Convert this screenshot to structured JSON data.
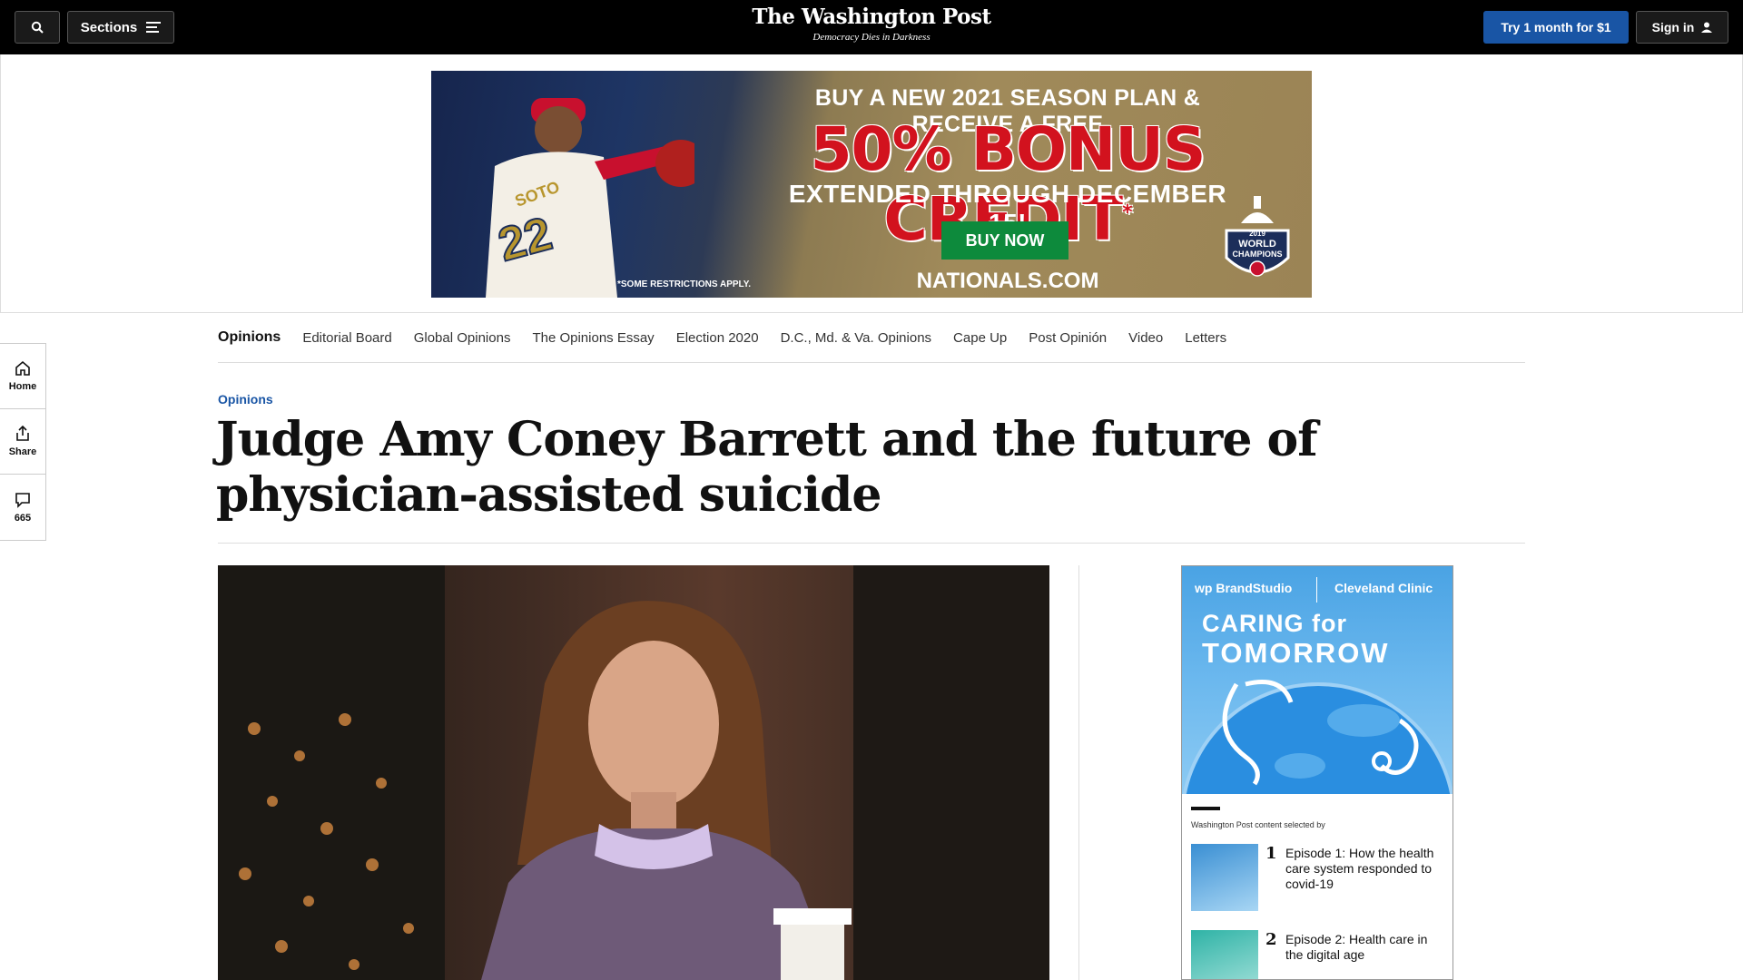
{
  "header": {
    "sections_label": "Sections",
    "logo": "The Washington Post",
    "tagline": "Democracy Dies in Darkness",
    "trial_label": "Try 1 month for $1",
    "signin_label": "Sign in"
  },
  "ad": {
    "line1": "BUY A NEW 2021 SEASON PLAN & RECEIVE A FREE",
    "line2": "50% BONUS CREDIT",
    "line2_mark": "*",
    "line3": "EXTENDED THROUGH DECEMBER 15!",
    "cta": "BUY NOW",
    "restrictions": "*SOME RESTRICTIONS APPLY.",
    "site": "NATIONALS.COM",
    "jersey_name": "SOTO",
    "jersey_number": "22",
    "badge_year": "2019",
    "badge_line1": "WORLD",
    "badge_line2": "CHAMPIONS"
  },
  "rail": {
    "home_label": "Home",
    "share_label": "Share",
    "comments_count": "665"
  },
  "nav": {
    "items": [
      "Opinions",
      "Editorial Board",
      "Global Opinions",
      "The Opinions Essay",
      "Election 2020",
      "D.C., Md. & Va. Opinions",
      "Cape Up",
      "Post Opinión",
      "Video",
      "Letters"
    ]
  },
  "article": {
    "kicker": "Opinions",
    "headline": "Judge Amy Coney Barrett and the future of physician-assisted suicide"
  },
  "promo": {
    "brand": "wp BrandStudio",
    "sponsor": "Cleveland Clinic",
    "title_line1": "CARING for",
    "title_line2": "TOMORROW",
    "selected_by": "Washington Post content selected by",
    "items": [
      {
        "num": "1",
        "text": "Episode 1: How the health care system responded to covid-19"
      },
      {
        "num": "2",
        "text": "Episode 2: Health care in the digital age"
      }
    ]
  }
}
